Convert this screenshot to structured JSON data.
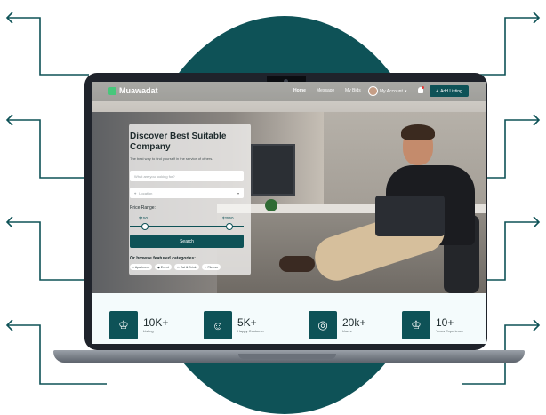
{
  "colors": {
    "brand": "#0e5257",
    "accent": "#47c77b"
  },
  "nav": {
    "brand": "Muawadat",
    "links": [
      "Home",
      "Message",
      "My Bids"
    ],
    "account": "My Account",
    "account_chevron": "▾",
    "add_listing": "Add Listing",
    "add_icon": "+"
  },
  "hero": {
    "title": "Discover Best Suitable Company",
    "subtitle": "The best way to find yourself in the service of others.",
    "search_placeholder": "What are you looking for?",
    "location_placeholder": "Location",
    "location_icon": "⌖",
    "location_chevron": "▾",
    "price_label": "Price Range:",
    "price_min": "$150",
    "price_max": "$2560",
    "search_button": "Search",
    "browse_label": "Or browse featured categories:",
    "categories": [
      {
        "icon": "⌂",
        "label": "Apartment"
      },
      {
        "icon": "◆",
        "label": "Event"
      },
      {
        "icon": "♨",
        "label": "Eat & Drink"
      },
      {
        "icon": "✦",
        "label": "Fitness"
      }
    ]
  },
  "stats": [
    {
      "icon": "♔",
      "value": "10K+",
      "label": "Listing"
    },
    {
      "icon": "☺",
      "value": "5K+",
      "label": "Happy Customer"
    },
    {
      "icon": "◎",
      "value": "20k+",
      "label": "Users"
    },
    {
      "icon": "♔",
      "value": "10+",
      "label": "Years Experience"
    }
  ]
}
